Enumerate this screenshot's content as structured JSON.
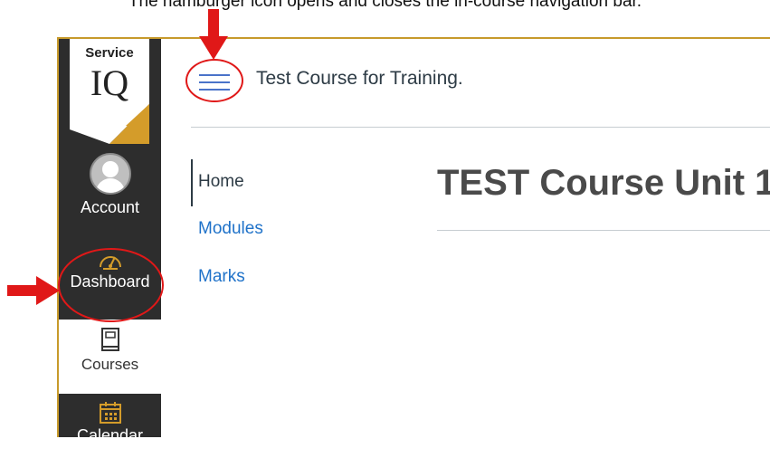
{
  "caption": "The hamburger icon opens and closes the in-course navigation bar.",
  "global_nav": {
    "logo_text_top": "Service",
    "logo_text_bottom": "IQ",
    "account_label": "Account",
    "dashboard_label": "Dashboard",
    "courses_label": "Courses",
    "calendar_label": "Calendar"
  },
  "course_header": {
    "title": "Test Course for Training."
  },
  "course_nav": {
    "items": [
      {
        "label": "Home",
        "active": true
      },
      {
        "label": "Modules",
        "active": false
      },
      {
        "label": "Marks",
        "active": false
      }
    ]
  },
  "main": {
    "heading": "TEST Course Unit 1"
  },
  "colors": {
    "annotation_red": "#e01818",
    "nav_dark": "#2d2d2d",
    "brand_gold": "#c79a2b",
    "link_blue": "#1f72c9",
    "hamburger_blue": "#4a73c9"
  },
  "icons": [
    "hamburger-icon",
    "avatar-icon",
    "dashboard-gauge-icon",
    "courses-book-icon",
    "calendar-icon",
    "arrow-down-icon",
    "arrow-right-icon"
  ]
}
